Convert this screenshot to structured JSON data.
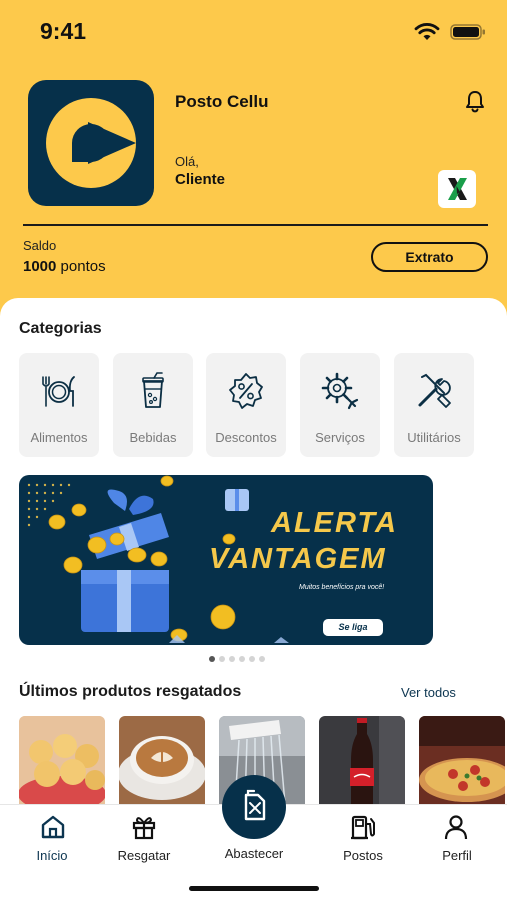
{
  "status_bar": {
    "time": "9:41",
    "icons": [
      "wifi-icon",
      "battery-icon"
    ]
  },
  "header": {
    "store_name": "Posto Cellu",
    "greeting": "Olá,",
    "user_name": "Cliente",
    "notifications_icon": "bell-icon",
    "partner_badge_icon": "x-logo-icon",
    "balance": {
      "label": "Saldo",
      "value": "1000",
      "unit": "pontos"
    },
    "statement_button": "Extrato"
  },
  "categories": {
    "title": "Categorias",
    "items": [
      {
        "label": "Alimentos",
        "icon": "cutlery-icon"
      },
      {
        "label": "Bebidas",
        "icon": "drink-icon"
      },
      {
        "label": "Descontos",
        "icon": "discount-icon"
      },
      {
        "label": "Serviços",
        "icon": "gear-wrench-icon"
      },
      {
        "label": "Utilitários",
        "icon": "tools-icon"
      }
    ]
  },
  "banner": {
    "line1": "ALERTA",
    "line2": "VANTAGEM",
    "subtitle": "Muitos benefícios pra você!",
    "cta": "Se liga",
    "pages": 6,
    "active_page": 1
  },
  "redeemed": {
    "title": "Últimos produtos resgatados",
    "see_all": "Ver todos",
    "items": [
      "pao-de-queijo-image",
      "cappuccino-image",
      "car-wash-image",
      "coca-cola-image",
      "pizza-image"
    ]
  },
  "tabbar": {
    "tabs": [
      {
        "label": "Início",
        "icon": "home-icon",
        "active": true
      },
      {
        "label": "Resgatar",
        "icon": "gift-icon",
        "active": false
      },
      {
        "label": "Abastecer",
        "icon": "fuel-can-icon",
        "active": false
      },
      {
        "label": "Postos",
        "icon": "gas-station-icon",
        "active": false
      },
      {
        "label": "Perfil",
        "icon": "user-icon",
        "active": false
      }
    ]
  },
  "colors": {
    "brand_yellow": "#FDC94B",
    "brand_navy": "#06304A",
    "active_tab": "#0C3550"
  }
}
